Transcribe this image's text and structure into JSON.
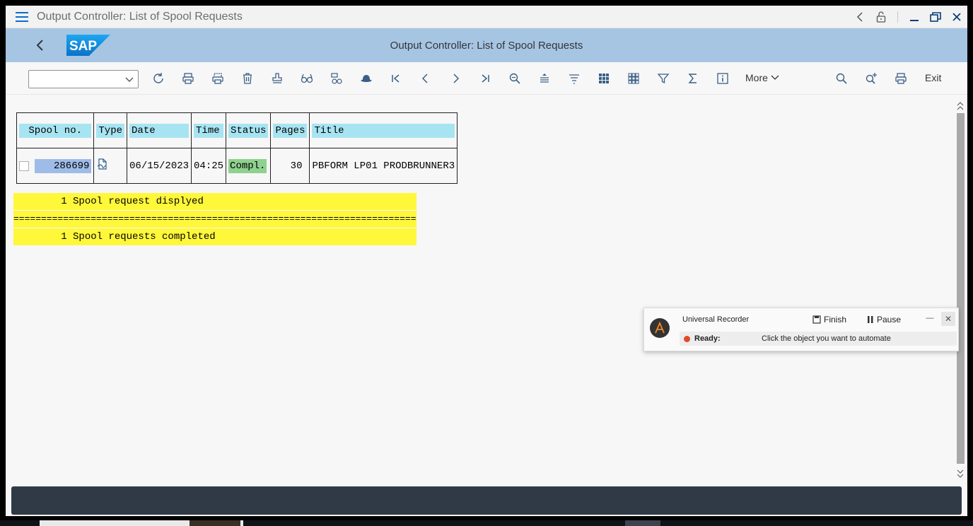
{
  "window": {
    "title": "Output Controller: List of Spool Requests"
  },
  "header": {
    "logo_text": "SAP",
    "screen_title": "Output Controller: List of Spool Requests"
  },
  "toolbar": {
    "combo_value": "",
    "more_label": "More",
    "exit_label": "Exit"
  },
  "table": {
    "headers": [
      "Spool no.",
      "Type",
      "Date",
      "Time",
      "Status",
      "Pages",
      "Title"
    ],
    "rows": [
      {
        "spool_no": "286699",
        "type_icon": "pdf-document-icon",
        "date": "06/15/2023",
        "time": "04:25",
        "status": "Compl.",
        "pages": "30",
        "title": "PBFORM LP01 PRODBRUNNER3"
      }
    ]
  },
  "summary": {
    "line1": "        1 Spool request displyed",
    "separator": "=========================================================================",
    "line2": "        1 Spool requests completed"
  },
  "recorder": {
    "title": "Universal Recorder",
    "finish_label": "Finish",
    "pause_label": "Pause",
    "status_label": "Ready:",
    "status_message": "Click the object you want to automate"
  },
  "colors": {
    "header_bg": "#a6c5e2",
    "col_header_bg": "#a7e4f2",
    "selected_cell_bg": "#9fbce8",
    "status_ok_bg": "#8fd18f",
    "summary_bg": "#fff73a",
    "statusbar_bg": "#2f3a46"
  }
}
